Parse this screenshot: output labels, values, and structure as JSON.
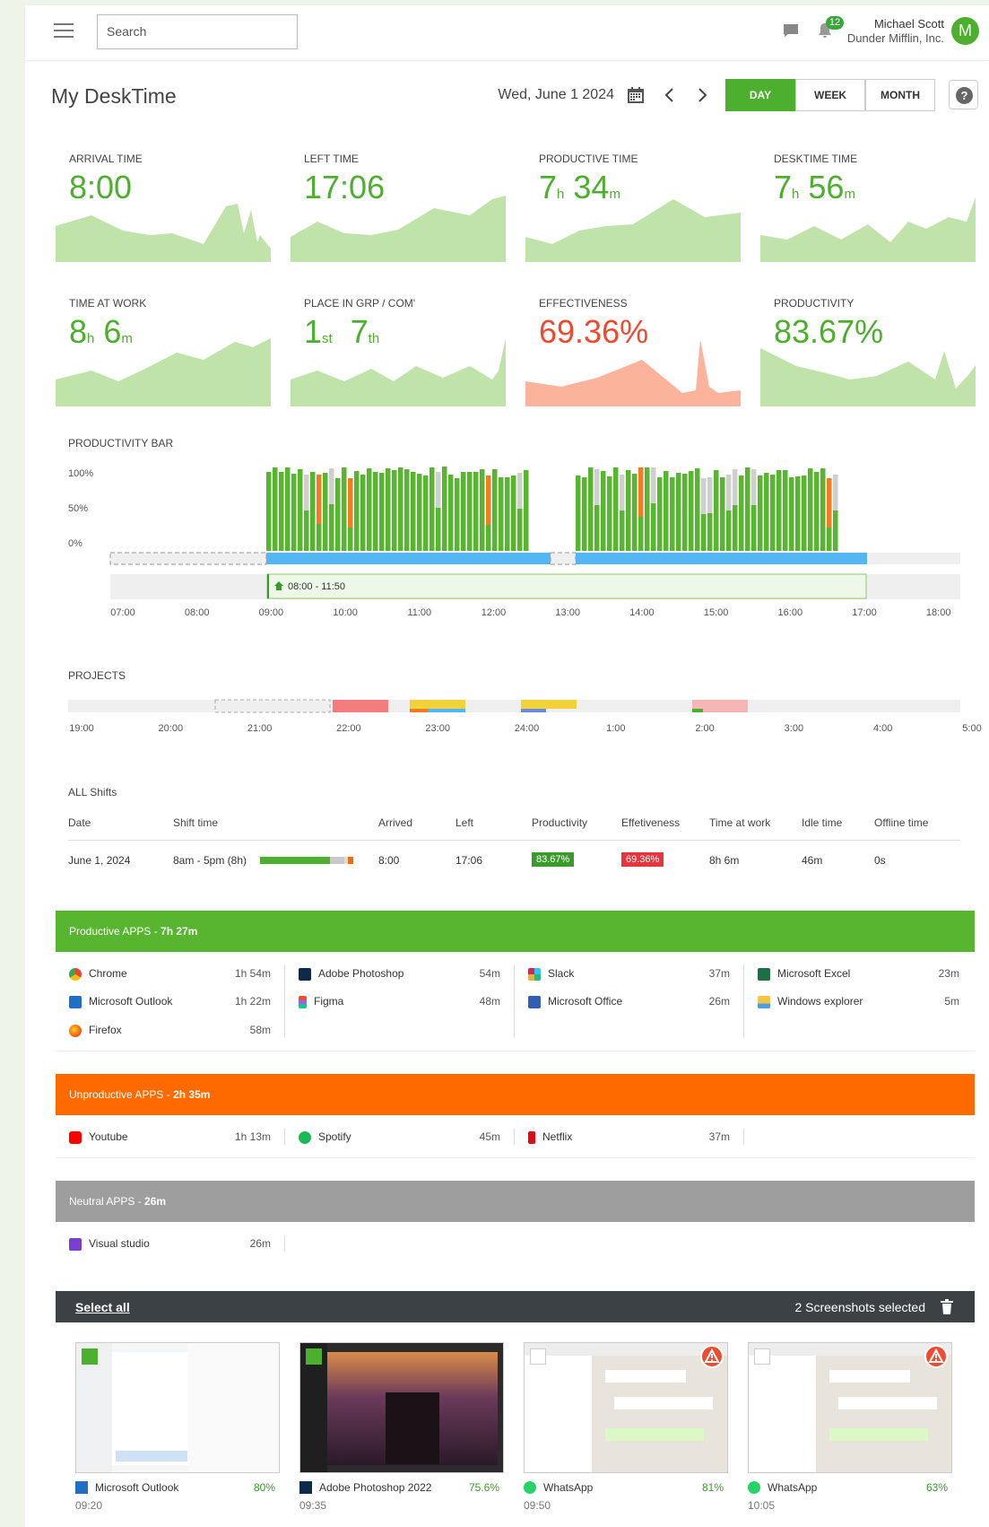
{
  "header": {
    "search_placeholder": "Search",
    "notification_count": "12",
    "user_name": "Michael Scott",
    "company": "Dunder Mifflin, Inc.",
    "avatar_letter": "M"
  },
  "page": {
    "title": "My DeskTime",
    "date": "Wed, June 1 2024",
    "tabs": [
      "DAY",
      "WEEK",
      "MONTH"
    ],
    "active_tab": "DAY",
    "help": "?"
  },
  "stats": [
    {
      "label": "ARRIVAL TIME",
      "value": "8:00"
    },
    {
      "label": "LEFT TIME",
      "value": "17:06"
    },
    {
      "label": "PRODUCTIVE TIME",
      "v1": "7",
      "u1": "h",
      "v2": "34",
      "u2": "m"
    },
    {
      "label": "DESKTIME TIME",
      "v1": "7",
      "u1": "h",
      "v2": "56",
      "u2": "m"
    },
    {
      "label": "TIME AT WORK",
      "v1": "8",
      "u1": "h",
      "v2": "6",
      "u2": "m"
    },
    {
      "label": "PLACE IN GRP / COM'",
      "v1": "1",
      "u1": "st",
      "v2": "7",
      "u2": "th"
    },
    {
      "label": "EFFECTIVENESS",
      "value": "69.36%"
    },
    {
      "label": "PRODUCTIVITY",
      "value": "83.67%"
    }
  ],
  "productivity_bar": {
    "title": "PRODUCTIVITY BAR",
    "y_ticks": [
      "100%",
      "50%",
      "0%"
    ],
    "x_ticks": [
      "07:00",
      "08:00",
      "09:00",
      "10:00",
      "11:00",
      "12:00",
      "13:00",
      "14:00",
      "15:00",
      "16:00",
      "17:00",
      "18:00"
    ],
    "shift_label": "08:00 - 11:50"
  },
  "projects": {
    "title": "PROJECTS",
    "x_ticks": [
      "19:00",
      "20:00",
      "21:00",
      "22:00",
      "23:00",
      "24:00",
      "1:00",
      "2:00",
      "3:00",
      "4:00",
      "5:00"
    ]
  },
  "shifts": {
    "title": "ALL Shifts",
    "headers": [
      "Date",
      "Shift time",
      "Arrived",
      "Left",
      "Productivity",
      "Effetiveness",
      "Time at work",
      "Idle time",
      "Offline time"
    ],
    "row": {
      "date": "June 1, 2024",
      "shift": "8am - 5pm (8h)",
      "arrived": "8:00",
      "left": "17:06",
      "productivity": "83.67%",
      "effectiveness": "69.36%",
      "time_at_work": "8h 6m",
      "idle": "46m",
      "offline": "0s"
    }
  },
  "productive_apps": {
    "title": "Productive APPS - ",
    "total": "7h 27m",
    "color": "#57b52f",
    "apps": [
      {
        "name": "Chrome",
        "time": "1h 54m"
      },
      {
        "name": "Microsoft Outlook",
        "time": "1h 22m"
      },
      {
        "name": "Firefox",
        "time": "58m"
      },
      {
        "name": "Adobe Photoshop",
        "time": "54m"
      },
      {
        "name": "Figma",
        "time": "48m"
      },
      {
        "name": "Slack",
        "time": "37m"
      },
      {
        "name": "Microsoft Office",
        "time": "26m"
      },
      {
        "name": "Microsoft Excel",
        "time": "23m"
      },
      {
        "name": "Windows explorer",
        "time": "5m"
      }
    ]
  },
  "unproductive_apps": {
    "title": "Unproductive APPS - ",
    "total": "2h 35m",
    "color": "#ff6a00",
    "apps": [
      {
        "name": "Youtube",
        "time": "1h 13m"
      },
      {
        "name": "Spotify",
        "time": "45m"
      },
      {
        "name": "Netflix",
        "time": "37m"
      }
    ]
  },
  "neutral_apps": {
    "title": "Neutral APPS - ",
    "total": "26m",
    "color": "#9e9e9e",
    "apps": [
      {
        "name": "Visual studio",
        "time": "26m"
      }
    ]
  },
  "screenshots": {
    "select_all": "Select all",
    "selected_text": "2 Screenshots selected",
    "items": [
      {
        "app": "Microsoft Outlook",
        "pct": "80%",
        "time": "09:20"
      },
      {
        "app": "Adobe Photoshop 2022",
        "pct": "75.6%",
        "time": "09:35"
      },
      {
        "app": "WhatsApp",
        "pct": "81%",
        "time": "09:50"
      },
      {
        "app": "WhatsApp",
        "pct": "63%",
        "time": "10:05"
      }
    ]
  }
}
